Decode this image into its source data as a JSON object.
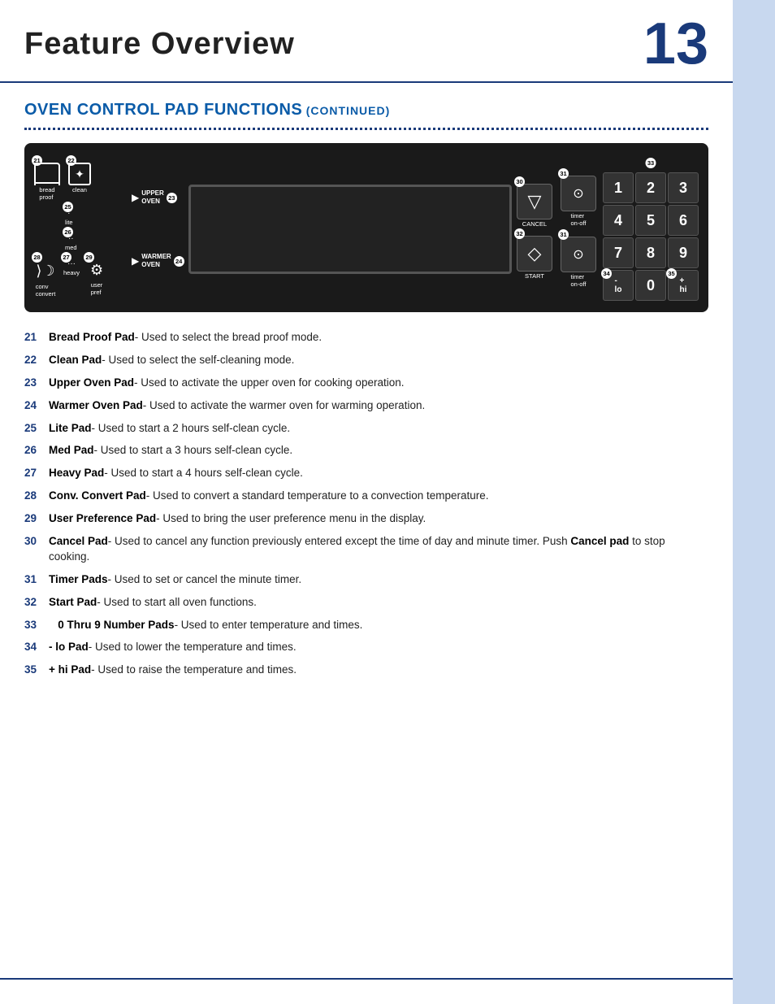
{
  "header": {
    "title": "Feature Overview",
    "page_number": "13"
  },
  "section": {
    "title_main": "OVEN CONTROL PAD FUNCTIONS",
    "title_sub": "(CONTINUED)"
  },
  "control_panel": {
    "buttons": {
      "bread_proof": {
        "num": "21",
        "label": "bread\nproof"
      },
      "clean": {
        "num": "22",
        "label": "clean"
      },
      "upper_oven": {
        "num": "23",
        "label": "UPPER\nOVEN"
      },
      "warmer_oven": {
        "num": "24",
        "label": "WARMER\nOVEN"
      },
      "lite": {
        "num": "25",
        "label": "lite"
      },
      "med": {
        "num": "26",
        "label": "med"
      },
      "heavy": {
        "num": "27",
        "label": "heavy"
      },
      "conv_convert": {
        "num": "28",
        "label": "conv\nconvert"
      },
      "user_pref": {
        "num": "29",
        "label": "user\npref"
      },
      "cancel": {
        "num": "30",
        "label": "CANCEL"
      },
      "start": {
        "num": "32",
        "label": "START"
      },
      "timer_on_off_upper": {
        "num": "31",
        "label": "timer\non-off"
      },
      "timer_on_off_lower": {
        "num": "31",
        "label": "timer\non-off"
      }
    },
    "numpad": {
      "badge_top": "33",
      "keys": [
        "1",
        "2",
        "3",
        "4",
        "5",
        "6",
        "7",
        "8",
        "9",
        "-\nlo",
        "0",
        "+\nhi"
      ],
      "key_nums": [
        "",
        "",
        "",
        "",
        "",
        "",
        "",
        "",
        "",
        "34",
        "",
        "35"
      ]
    }
  },
  "features": [
    {
      "num": "21",
      "label": "Bread Proof Pad",
      "desc": "- Used to select the bread proof mode."
    },
    {
      "num": "22",
      "label": "Clean Pad",
      "desc": "- Used to select the self-cleaning mode."
    },
    {
      "num": "23",
      "label": "Upper Oven Pad",
      "desc": "- Used to activate the upper oven for cooking operation."
    },
    {
      "num": "24",
      "label": "Warmer Oven Pad",
      "desc": "- Used to activate the warmer oven for warming operation."
    },
    {
      "num": "25",
      "label": "Lite Pad",
      "desc": "- Used to start a 2 hours self-clean cycle."
    },
    {
      "num": "26",
      "label": "Med Pad",
      "desc": "- Used to start a 3 hours self-clean cycle."
    },
    {
      "num": "27",
      "label": "Heavy Pad",
      "desc": "- Used to start a 4 hours self-clean cycle."
    },
    {
      "num": "28",
      "label": "Conv. Convert Pad",
      "desc": "- Used to convert a standard temperature to a convection temperature."
    },
    {
      "num": "29",
      "label": "User Preference Pad",
      "desc": "- Used to bring the user preference menu in the display."
    },
    {
      "num": "30",
      "label": "Cancel Pad",
      "desc": "- Used to cancel any function previously entered except the time of day and minute timer. Push ",
      "bold_part": "Cancel pad",
      "desc2": " to stop cooking."
    },
    {
      "num": "31",
      "label": "Timer Pads",
      "desc": "- Used to set or cancel the minute timer."
    },
    {
      "num": "32",
      "label": "Start Pad",
      "desc": "- Used to start all oven functions."
    },
    {
      "num": "33",
      "label": "0 Thru 9 Number Pads",
      "desc": "- Used to enter temperature and times.",
      "indent": true
    },
    {
      "num": "34",
      "label": "- lo Pad",
      "desc": "- Used to lower the temperature and times."
    },
    {
      "num": "35",
      "label": "+ hi Pad",
      "desc": "- Used to raise the temperature and times."
    }
  ]
}
